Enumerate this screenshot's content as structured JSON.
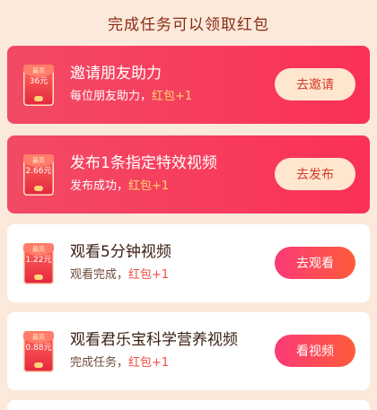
{
  "header": {
    "title": "完成任务可以领取红包"
  },
  "tasks": [
    {
      "badge_label": "最高",
      "badge_amount": "36元",
      "title": "邀请朋友助力",
      "desc": "每位朋友助力，",
      "reward": "红包+1",
      "button": "去邀请"
    },
    {
      "badge_label": "最高",
      "badge_amount": "2.66元",
      "title": "发布1条指定特效视频",
      "desc": "发布成功，",
      "reward": "红包+1",
      "button": "去发布"
    },
    {
      "badge_label": "最高",
      "badge_amount": "1.22元",
      "title": "观看5分钟视频",
      "desc": "观看完成，",
      "reward": "红包+1",
      "button": "去观看"
    },
    {
      "badge_label": "最高",
      "badge_amount": "0.88元",
      "title": "观看君乐宝科学营养视频",
      "desc": "完成任务，",
      "reward": "红包+1",
      "button": "看视频"
    }
  ],
  "colors": {
    "background": "#fbe9dc",
    "highlight_card": "#f73a5c",
    "reward_highlight": "#ffd86b",
    "reward_normal": "#f24a45",
    "button_gradient_start": "#fb3a78",
    "button_gradient_end": "#fd5b3a"
  },
  "icons": {
    "task_badge": "red-envelope-icon"
  }
}
